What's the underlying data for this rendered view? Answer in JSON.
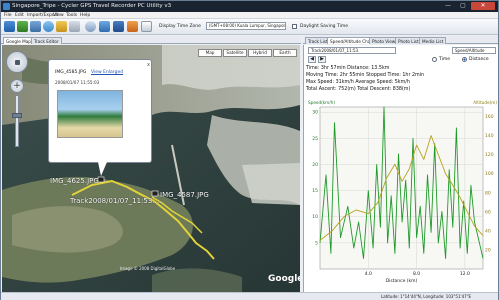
{
  "window": {
    "title": "Singapore_Tripe - Cycler GPS Travel Recorder PC Utility v3",
    "min_glyph": "—",
    "max_glyph": "▢",
    "close_glyph": "✕"
  },
  "menu": {
    "items": [
      "File",
      "Edit",
      "Import/Export",
      "View",
      "Tools",
      "Help"
    ]
  },
  "toolbar": {
    "display_time_zone_label": "Display Time Zone",
    "time_zone_value": "(GMT+08:00) Kuala Lumpur, Singapore",
    "daylight_saving_label": "Daylight Saving Time"
  },
  "left_tabs": [
    "Google Map",
    "Track Editor"
  ],
  "map": {
    "tooltip_title": "IMG_4585.JPG",
    "tooltip_link": "View Enlarged",
    "tooltip_date": "2008/01/07 11:55:03",
    "tooltip_close": "x",
    "search_buttons": [
      "Map",
      "Satellite",
      "Hybrid",
      "Earth"
    ],
    "labels": {
      "img_a": "IMG_4625.JPG",
      "img_b": "IMG_4587.JPG",
      "track": "Track2008/01/07_11:53:..."
    },
    "scale_text": "Image © 2008 DigitalGlobe",
    "google_text": "Google",
    "colors": {
      "track": "#d8c830",
      "sea": "#314646",
      "land": "#c7cbc5"
    }
  },
  "status": {
    "text": "Latitude: 1°14'44\"N, Longitude: 103°51'47\"E"
  },
  "right_tabs": [
    "Track List",
    "Speed/Altitude Chart",
    "Photo View",
    "Photo List",
    "Media List"
  ],
  "track_panel": {
    "track_select": "Track2008/01/07_11:53",
    "chart_select": "Speed/Altitude",
    "unit_labels": [
      "Time",
      "Distance"
    ],
    "stats": {
      "line1": "Time: 3hr 57min   Distance: 13.5km",
      "line2": "Moving Time: 2hr 55min   Stopped Time: 1hr 2min",
      "line3": "Max Speed: 31km/h   Average Speed: 5km/h",
      "line4": "Total Ascent: 752(m)   Total Descent: 838(m)"
    }
  },
  "chart_data": {
    "type": "line",
    "ylabel_left": "Speed(km/h)",
    "ylabel_right": "Altitude(m)",
    "xlabel": "Distance (km)",
    "x_ticks": [
      "4.0",
      "8.0",
      "12.0"
    ],
    "y_left_ticks": [
      "30",
      "25",
      "20",
      "15",
      "10",
      "5"
    ],
    "y_right_ticks": [
      "160",
      "140",
      "120",
      "100",
      "80",
      "60",
      "40",
      "20"
    ],
    "xlim": [
      0,
      13.5
    ],
    "ylim_left": [
      0,
      31
    ],
    "ylim_right": [
      0,
      170
    ],
    "series": [
      {
        "name": "Speed(km/h)",
        "color": "#1f9a2a",
        "x": [
          0,
          0.5,
          0.9,
          1.2,
          1.7,
          2.3,
          2.8,
          3.2,
          3.6,
          4.0,
          4.4,
          4.7,
          5.0,
          5.3,
          5.6,
          5.9,
          6.2,
          6.5,
          6.8,
          7.1,
          7.4,
          7.7,
          8.0,
          8.3,
          8.6,
          8.9,
          9.2,
          9.5,
          9.8,
          10.1,
          10.4,
          10.7,
          11.0,
          11.3,
          11.6,
          11.9,
          12.2,
          12.5,
          12.8,
          13.1,
          13.5
        ],
        "y": [
          5,
          18,
          3,
          28,
          6,
          12,
          4,
          9,
          2,
          15,
          4,
          20,
          8,
          31,
          5,
          14,
          3,
          22,
          9,
          17,
          4,
          25,
          6,
          12,
          3,
          18,
          7,
          24,
          5,
          11,
          2,
          19,
          8,
          27,
          4,
          13,
          3,
          16,
          9,
          6,
          2
        ]
      },
      {
        "name": "Altitude(m)",
        "color": "#b7a21d",
        "x": [
          0,
          1.0,
          2.0,
          3.0,
          4.0,
          4.8,
          5.5,
          6.2,
          6.8,
          7.4,
          8.0,
          8.6,
          9.2,
          9.8,
          10.4,
          11.0,
          11.6,
          12.2,
          12.8,
          13.5
        ],
        "y": [
          30,
          40,
          55,
          62,
          58,
          70,
          95,
          110,
          92,
          105,
          130,
          115,
          140,
          120,
          100,
          88,
          75,
          60,
          45,
          35
        ]
      }
    ]
  }
}
